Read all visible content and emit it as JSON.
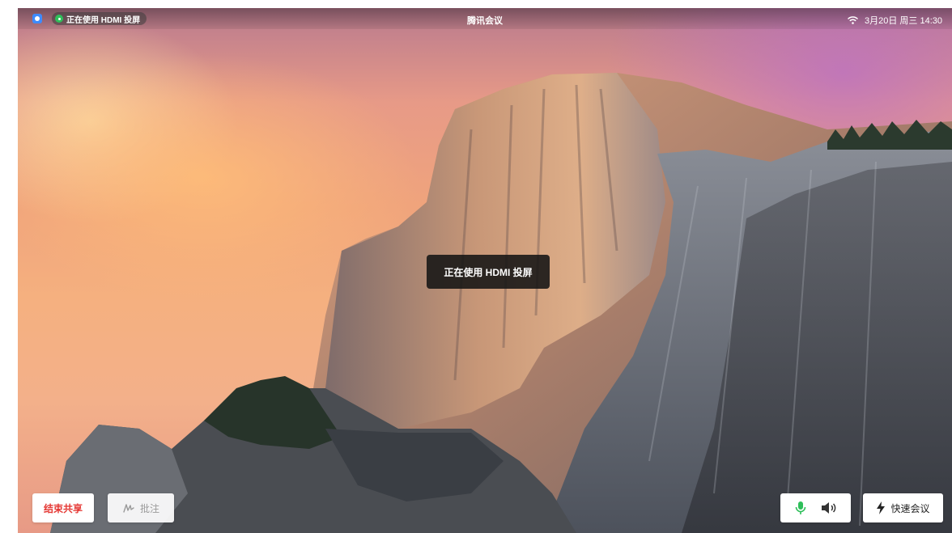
{
  "topbar": {
    "hdmi_status": "正在使用 HDMI 投屏",
    "app_title": "腾讯会议",
    "datetime": "3月20日 周三 14:30"
  },
  "toast": {
    "message": "正在使用 HDMI 投屏"
  },
  "toolbar": {
    "end_share_label": "结束共享",
    "annotate_label": "批注",
    "quick_meeting_label": "快速会议"
  },
  "icons": {
    "app": "tencent-meeting-icon",
    "status_dot": "status-dot-icon",
    "wifi": "wifi-icon",
    "annotate": "pen-icon",
    "mic": "microphone-icon",
    "speaker": "speaker-icon",
    "quick": "lightning-icon"
  },
  "colors": {
    "end_share_text": "#e53935",
    "mic_green": "#2fbf5a",
    "hdmi_dot": "#2fbf5a",
    "app_badge": "#3d8bff"
  }
}
